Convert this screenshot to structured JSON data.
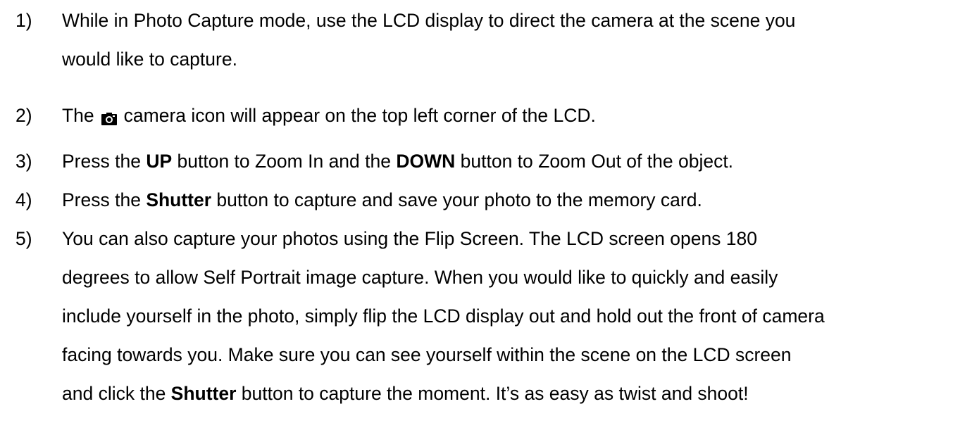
{
  "instructions": [
    {
      "number": "1)",
      "lines": [
        "While in Photo Capture mode, use the LCD display to direct the camera at the scene you",
        "would like to capture."
      ]
    },
    {
      "number": "2)",
      "before_icon": "The",
      "icon": "camera-icon",
      "after_icon": "camera icon will appear on the top left corner of the LCD."
    },
    {
      "number": "3)",
      "parts": [
        "Press the ",
        "UP",
        " button to Zoom In and the ",
        "DOWN",
        " button to Zoom Out of the object."
      ]
    },
    {
      "number": "4)",
      "parts": [
        "Press the ",
        "Shutter",
        " button to capture and save your photo to the memory card."
      ]
    },
    {
      "number": "5)",
      "lines": [
        "You can also capture your photos using the Flip Screen. The LCD screen opens 180",
        "degrees to allow Self Portrait image capture. When you would like to quickly and easily",
        "include yourself in the photo, simply flip the LCD display out and hold out the front of camera",
        "facing towards you. Make sure you can see yourself within the scene on the LCD screen"
      ],
      "last_line_parts": [
        "and click the ",
        "Shutter",
        " button to capture the moment. It’s as easy as twist and shoot!"
      ]
    }
  ]
}
